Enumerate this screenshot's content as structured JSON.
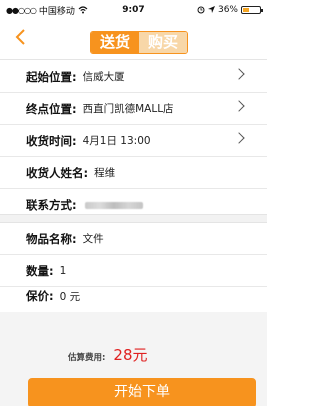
{
  "status_bar": {
    "signal": "●●○○○",
    "carrier": "中国移动",
    "wifi_icon": "wifi-icon",
    "time": "9:07",
    "battery_percent": "36%",
    "battery_level": 0.36
  },
  "nav": {
    "back_icon": "chevron-left-icon",
    "tabs": [
      {
        "label": "送货",
        "active": true
      },
      {
        "label": "购买",
        "active": false
      }
    ]
  },
  "form": {
    "pickup": {
      "label": "起始位置:",
      "value": "信威大厦"
    },
    "dest": {
      "label": "终点位置:",
      "value": "西直门凯德MALL店"
    },
    "time": {
      "label": "收货时间:",
      "value": "4月1日 13:00"
    },
    "name": {
      "label": "收货人姓名:",
      "value": "程维"
    },
    "contact": {
      "label": "联系方式:"
    }
  },
  "item": {
    "name": {
      "label": "物品名称:",
      "value": "文件"
    },
    "qty": {
      "label": "数量:",
      "value": "1"
    },
    "insure": {
      "label": "保价:",
      "value": "0 元"
    }
  },
  "footer": {
    "estimate_label": "估算费用:",
    "estimate_value": "28元",
    "start_button": "开始下单"
  },
  "colors": {
    "accent": "#f7931e",
    "price": "#e02020"
  }
}
